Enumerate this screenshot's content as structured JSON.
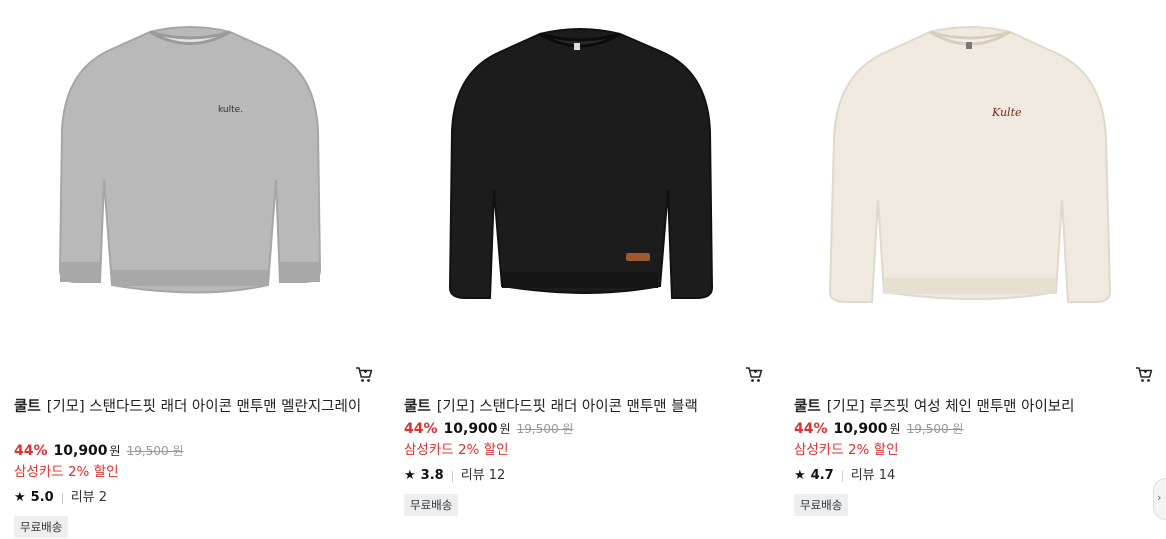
{
  "products": [
    {
      "brand": "쿨트",
      "name": "[기모] 스탠다드핏 래더 아이콘 맨투맨 멜란지그레이",
      "discount": "44%",
      "price": "10,900",
      "currency": "원",
      "original_price": "19,500",
      "original_currency": "원",
      "card_discount": "삼성카드 2% 할인",
      "rating": "5.0",
      "reviews": "리뷰 2",
      "badge": "무료배송",
      "image_color": "#b8b8b8",
      "logo_text": "kulte."
    },
    {
      "brand": "쿨트",
      "name": "[기모] 스탠다드핏 래더 아이콘 맨투맨 블랙",
      "discount": "44%",
      "price": "10,900",
      "currency": "원",
      "original_price": "19,500",
      "original_currency": "원",
      "card_discount": "삼성카드 2% 할인",
      "rating": "3.8",
      "reviews": "리뷰 12",
      "badge": "무료배송",
      "image_color": "#1c1c1c"
    },
    {
      "brand": "쿨트",
      "name": "[기모] 루즈핏 여성 체인 맨투맨 아이보리",
      "discount": "44%",
      "price": "10,900",
      "currency": "원",
      "original_price": "19,500",
      "original_currency": "원",
      "card_discount": "삼성카드 2% 할인",
      "rating": "4.7",
      "reviews": "리뷰 14",
      "badge": "무료배송",
      "image_color": "#efe9df",
      "logo_text": "Kulte"
    }
  ],
  "icons": {
    "cart": "cart-icon",
    "star": "star-icon"
  },
  "colors": {
    "discount_red": "#e03131"
  }
}
